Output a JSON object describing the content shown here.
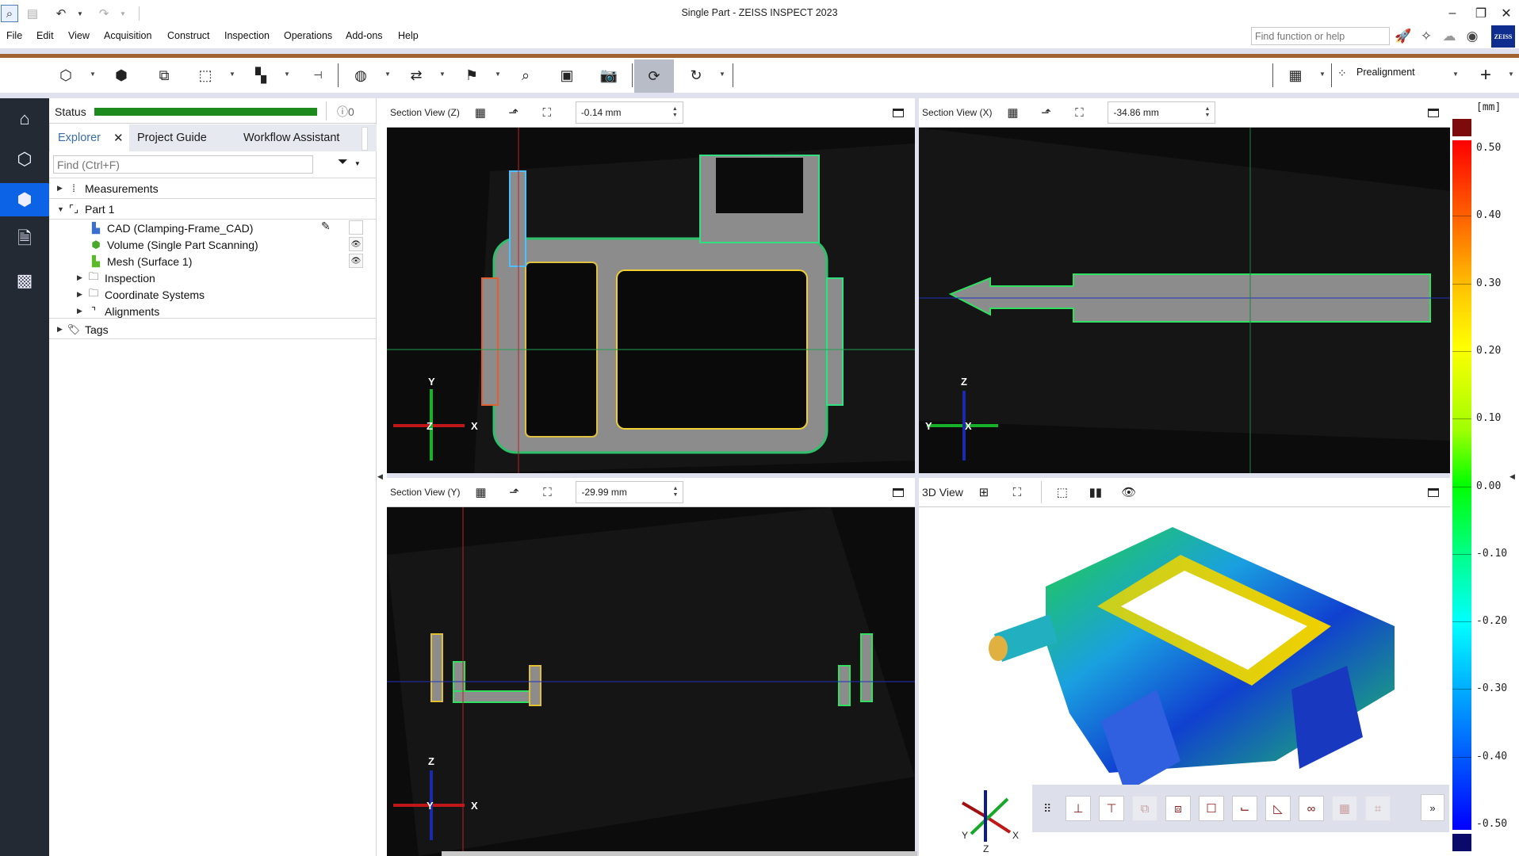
{
  "window": {
    "title": "Single Part - ZEISS INSPECT 2023",
    "controls": {
      "minimize": "–",
      "restore": "❐",
      "close": "✕"
    }
  },
  "quick_access": {
    "search": "search-icon",
    "save": "save-icon",
    "undo": "undo-icon",
    "redo": "redo-icon"
  },
  "menu": [
    "File",
    "Edit",
    "View",
    "Acquisition",
    "Construct",
    "Inspection",
    "Operations",
    "Add-ons",
    "Help"
  ],
  "header_right": {
    "find_placeholder": "Find function or help",
    "icons": [
      "rocket-icon",
      "puzzle-icon",
      "cloud-icon",
      "user-account-icon"
    ],
    "logo": "ZEISS"
  },
  "toolbar": {
    "alignment_label": "Prealignment",
    "accent_color": "#a0632f"
  },
  "status": {
    "label": "Status",
    "progress_percent": 100,
    "info_count": "0"
  },
  "panel_tabs": [
    {
      "label": "Explorer",
      "active": true,
      "close": "✕"
    },
    {
      "label": "Project Guide",
      "active": false
    },
    {
      "label": "Workflow Assistant",
      "active": false
    }
  ],
  "explorer": {
    "find_placeholder": "Find (Ctrl+F)",
    "tree": {
      "measurements": "Measurements",
      "part": "Part 1",
      "cad": "CAD (Clamping-Frame_CAD)",
      "volume": "Volume (Single Part Scanning)",
      "mesh": "Mesh (Surface 1)",
      "inspection": "Inspection",
      "coordinate_systems": "Coordinate Systems",
      "alignments": "Alignments",
      "tags": "Tags"
    }
  },
  "views": {
    "z": {
      "title": "Section View (Z)",
      "value": "-0.14 mm",
      "axes": {
        "v": "Y",
        "c": "Z",
        "h": "X"
      }
    },
    "x": {
      "title": "Section View (X)",
      "value": "-34.86 mm",
      "axes": {
        "v": "Z",
        "c": "X",
        "h": "Y"
      }
    },
    "y": {
      "title": "Section View (Y)",
      "value": "-29.99 mm",
      "axes": {
        "v": "Z",
        "c": "Y",
        "h": "X"
      }
    },
    "d3": {
      "title": "3D View",
      "axes": {
        "x": "X",
        "y": "Y",
        "z": "Z"
      }
    }
  },
  "legend": {
    "unit": "[mm]",
    "ticks": [
      "0.50",
      "0.40",
      "0.30",
      "0.20",
      "0.10",
      "0.00",
      "-0.10",
      "-0.20",
      "-0.30",
      "-0.40",
      "-0.50"
    ],
    "max_color": "#7d0b0b",
    "min_color": "#0a0a6a"
  },
  "toolbar3d": {
    "more": "»"
  }
}
